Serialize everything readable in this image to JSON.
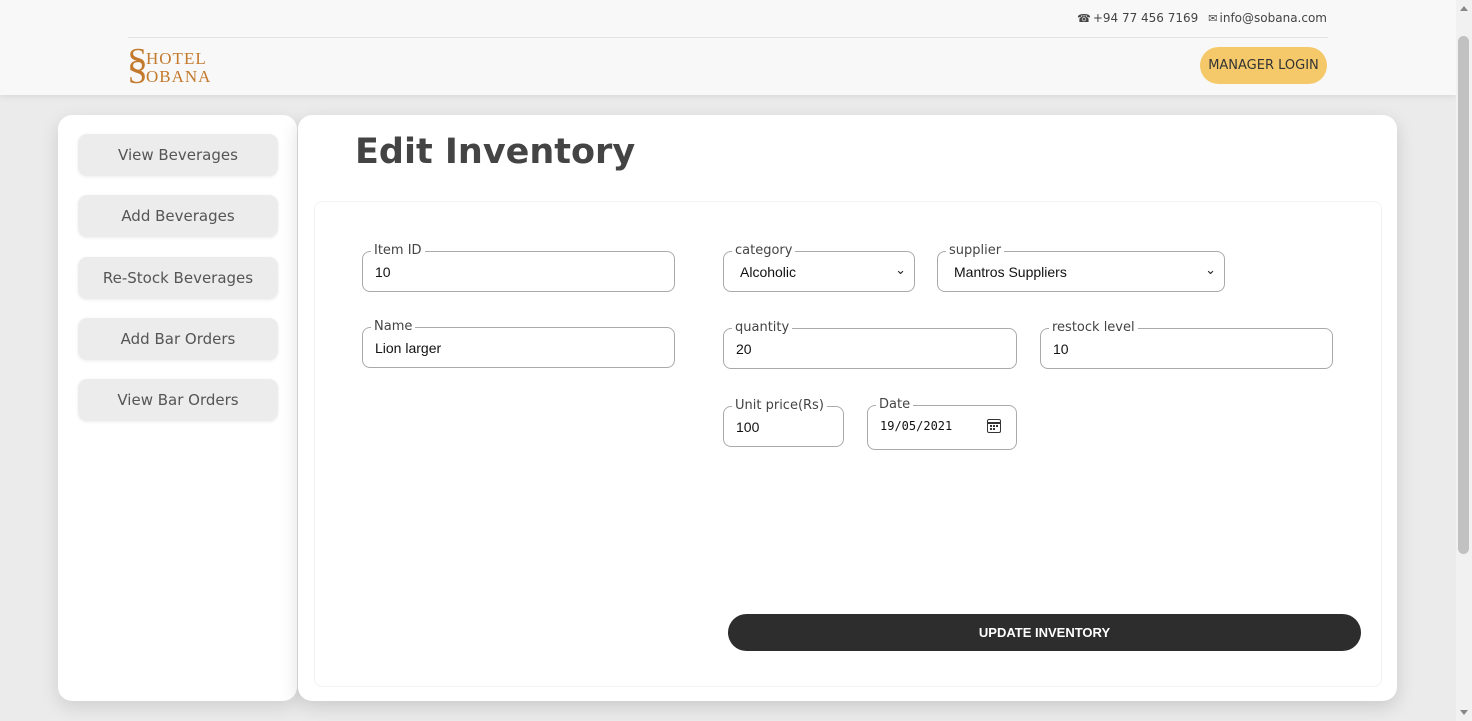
{
  "header": {
    "phone": "+94 77 456 7169",
    "email": "info@sobana.com",
    "logo": {
      "s": "S",
      "line1": "HOTEL",
      "line2": "OBANA"
    },
    "login_label": "MANAGER LOGIN",
    "accent_color": "#f5c96a"
  },
  "sidebar": {
    "items": [
      {
        "label": "View Beverages"
      },
      {
        "label": "Add Beverages"
      },
      {
        "label": "Re-Stock Beverages"
      },
      {
        "label": "Add Bar Orders"
      },
      {
        "label": "View Bar Orders"
      }
    ]
  },
  "main": {
    "title": "Edit Inventory",
    "fields": {
      "item_id": {
        "label": "Item ID",
        "value": "10"
      },
      "name": {
        "label": "Name",
        "value": "Lion larger"
      },
      "category": {
        "label": "category",
        "value": "Alcoholic"
      },
      "supplier": {
        "label": "supplier",
        "value": "Mantros Suppliers"
      },
      "quantity": {
        "label": "quantity",
        "value": "20"
      },
      "restock_level": {
        "label": "restock level",
        "value": "10"
      },
      "unit_price": {
        "label": "Unit price(Rs)",
        "value": "100"
      },
      "date": {
        "label": "Date",
        "value": "19/05/2021"
      }
    },
    "submit_label": "UPDATE INVENTORY"
  }
}
